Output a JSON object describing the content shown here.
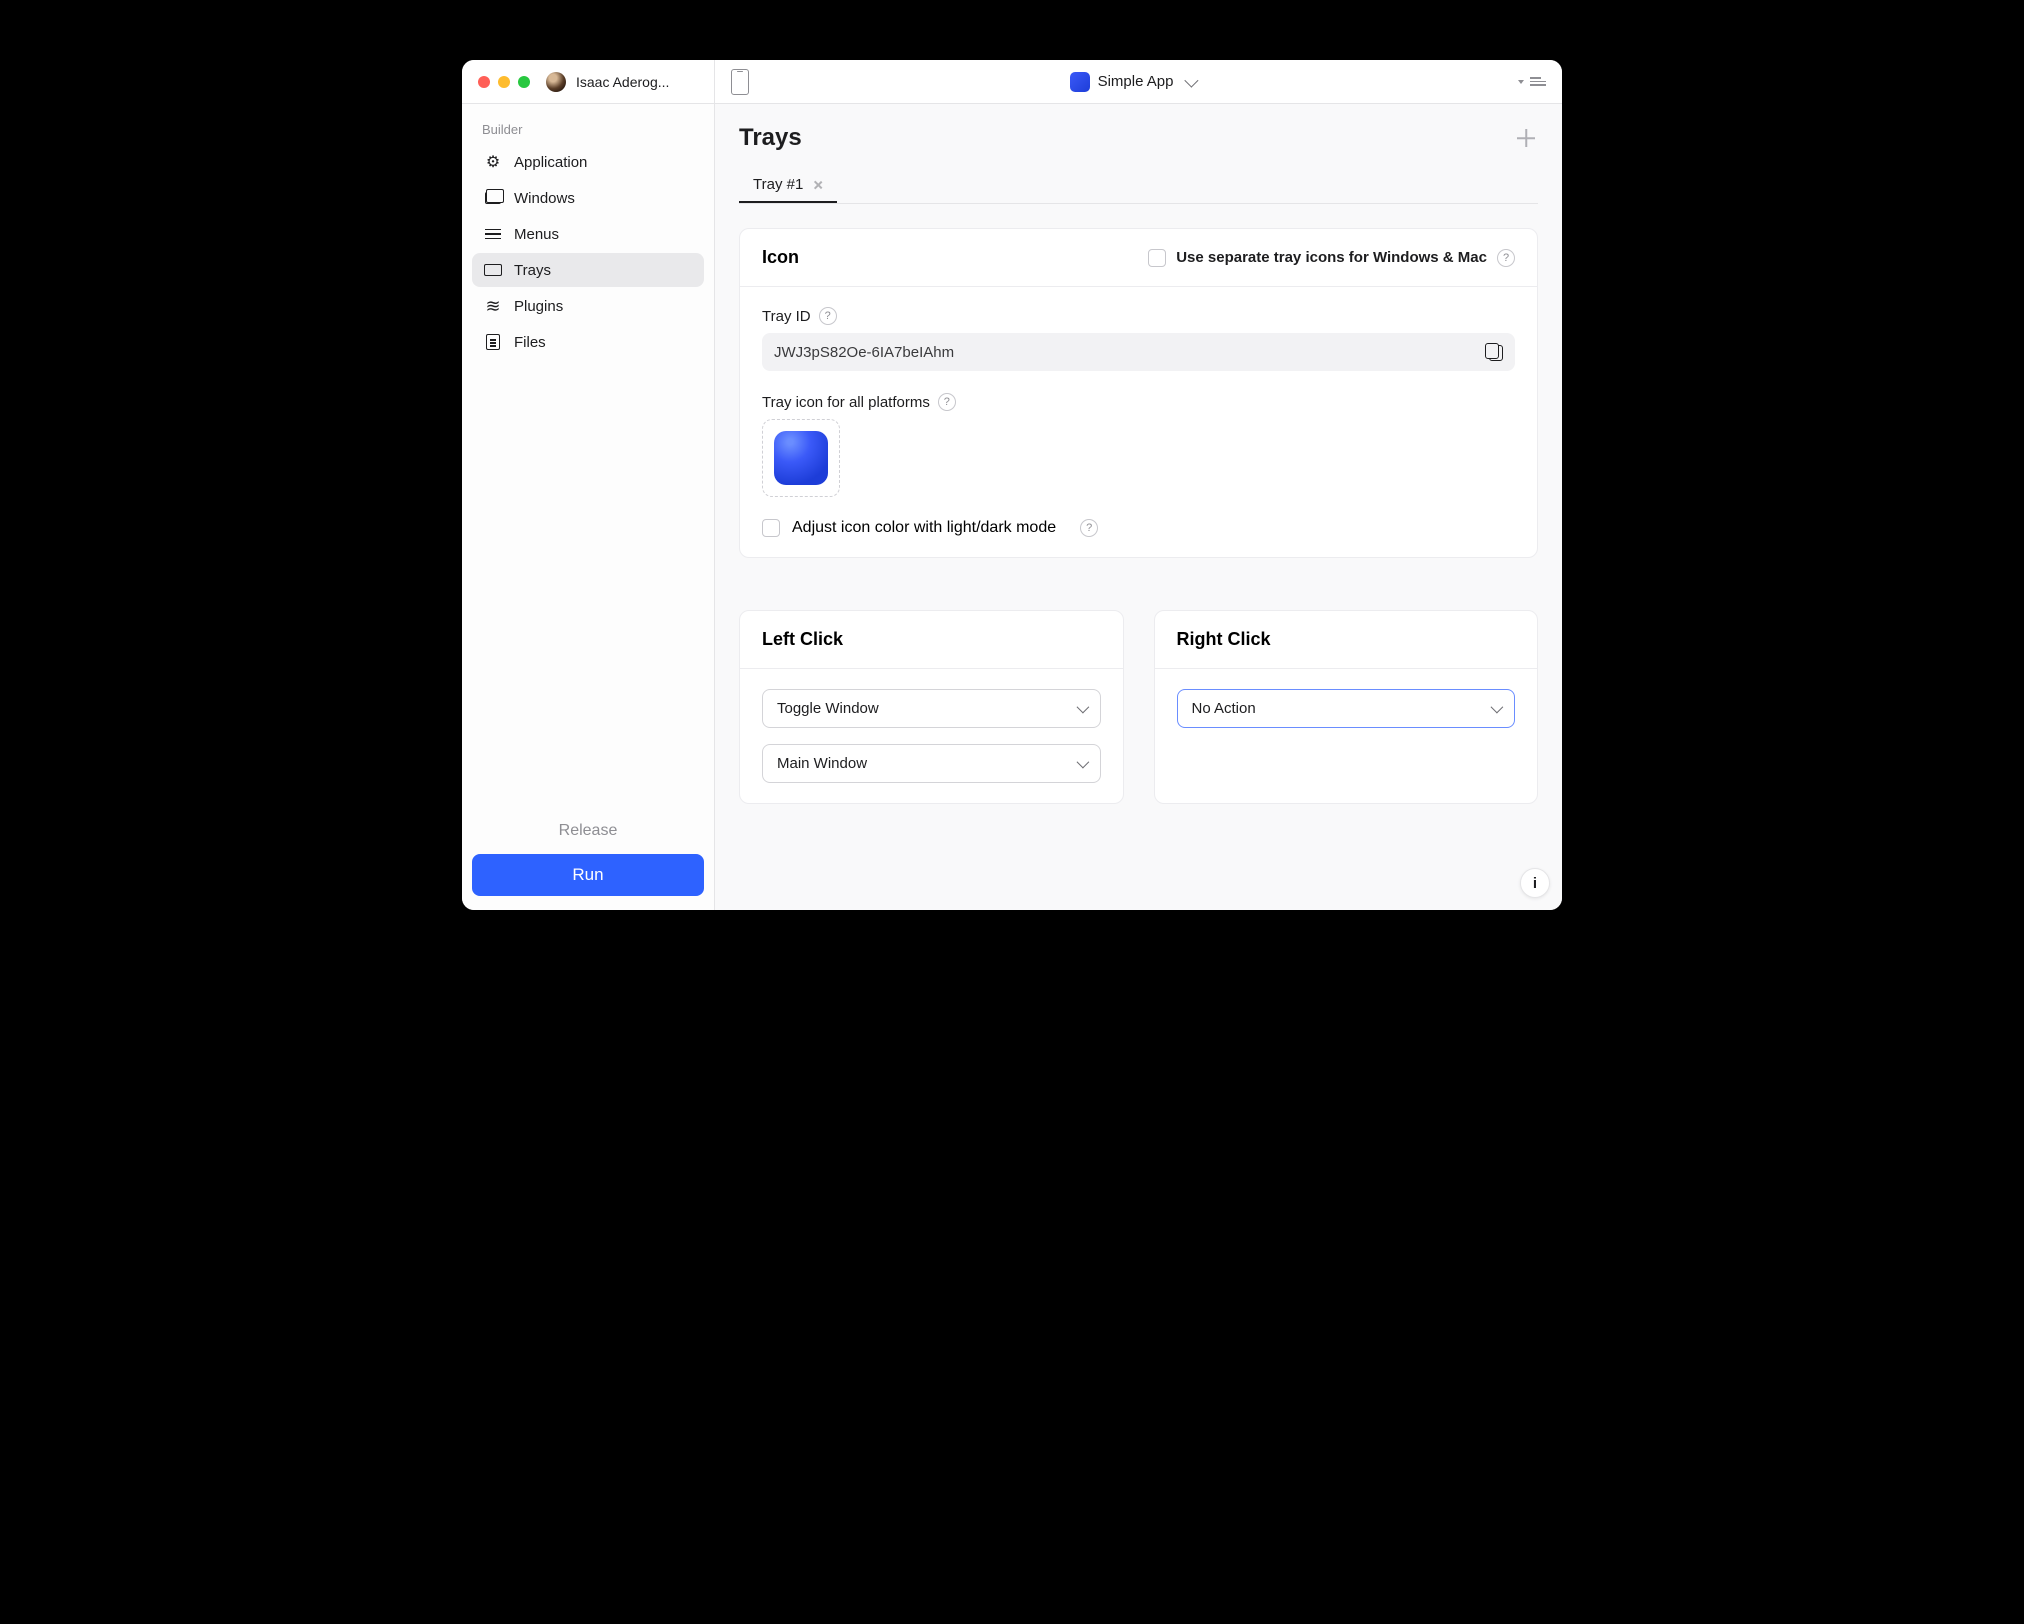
{
  "titlebar": {
    "user_name": "Isaac Aderog...",
    "app_name": "Simple App"
  },
  "sidebar": {
    "section": "Builder",
    "items": [
      {
        "label": "Application"
      },
      {
        "label": "Windows"
      },
      {
        "label": "Menus"
      },
      {
        "label": "Trays"
      },
      {
        "label": "Plugins"
      },
      {
        "label": "Files"
      }
    ],
    "release_label": "Release",
    "run_label": "Run"
  },
  "main": {
    "title": "Trays",
    "tabs": [
      {
        "label": "Tray #1"
      }
    ],
    "icon_card": {
      "title": "Icon",
      "separate_label": "Use separate tray icons for Windows & Mac",
      "tray_id_label": "Tray ID",
      "tray_id_value": "JWJ3pS82Oe-6IA7beIAhm",
      "tray_icon_label": "Tray icon for all platforms",
      "adjust_label": "Adjust icon color with light/dark mode"
    },
    "left_click": {
      "title": "Left Click",
      "select1": "Toggle Window",
      "select2": "Main Window"
    },
    "right_click": {
      "title": "Right Click",
      "select1": "No Action"
    }
  }
}
